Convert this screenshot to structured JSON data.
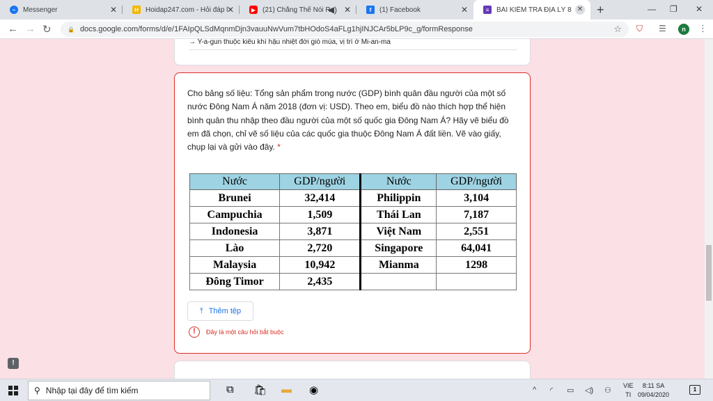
{
  "tabs": [
    {
      "title": "Messenger",
      "icon": "messenger-icon",
      "color": "#1877f2"
    },
    {
      "title": "Hoidap247.com - Hỏi đáp l",
      "icon": "hoidap-icon",
      "color": "#f4b400"
    },
    {
      "title": "(21) Chẳng Thể Nói Ra",
      "icon": "youtube-icon",
      "color": "#ff0000"
    },
    {
      "title": "(1) Facebook",
      "icon": "facebook-icon",
      "color": "#1877f2"
    },
    {
      "title": "BÀI KIỂM TRA ĐỊA LÝ 8",
      "icon": "google-forms-icon",
      "color": "#673ab7"
    }
  ],
  "url": "docs.google.com/forms/d/e/1FAIpQLSdMqnmDjn3vauuNwVum7tbHOdoS4aFLg1hjINJCAr5bLP9c_g/formResponse",
  "avatar_letter": "n",
  "prev_answer": "→ Y-a-gun thuộc kiểu khí hậu nhiệt đới gió mùa, vị trí ở Mi-an-ma",
  "question": {
    "text": "Cho bảng số liệu: Tổng sản phẩm trong nước (GDP) bình quân đầu người của một số nước Đông Nam Á năm 2018 (đơn vị: USD). Theo em, biểu đồ nào thích hợp thể hiện bình quân thu nhập theo đầu người của một số quốc gia Đông Nam Á? Hãy vẽ biểu đồ em đã chọn, chỉ vẽ số liệu của các quốc gia thuộc Đông Nam Á đất liền. Vẽ vào giấy, chụp lại và gửi vào đây.",
    "required_mark": "*",
    "table": {
      "headers": [
        "Nước",
        "GDP/người",
        "Nước",
        "GDP/người"
      ],
      "rows": [
        [
          "Brunei",
          "32,414",
          "Philippin",
          "3,104"
        ],
        [
          "Campuchia",
          "1,509",
          "Thái Lan",
          "7,187"
        ],
        [
          "Indonesia",
          "3,871",
          "Việt Nam",
          "2,551"
        ],
        [
          "Lào",
          "2,720",
          "Singapore",
          "64,041"
        ],
        [
          "Malaysia",
          "10,942",
          "Mianma",
          "1298"
        ],
        [
          "Đông Timor",
          "2,435",
          "",
          ""
        ]
      ]
    },
    "upload_label": "Thêm tệp",
    "error_text": "Đây là một câu hỏi bắt buộc"
  },
  "taskbar": {
    "search_placeholder": "Nhập tại đây để tìm kiếm",
    "lang_line1": "VIE",
    "lang_line2": "TI",
    "time": "8:11 SA",
    "date": "09/04/2020",
    "notification_count": "1"
  },
  "colors": {
    "error": "#d93025",
    "header_fill": "#9ed3e3",
    "page_bg": "#fbe0e5"
  }
}
